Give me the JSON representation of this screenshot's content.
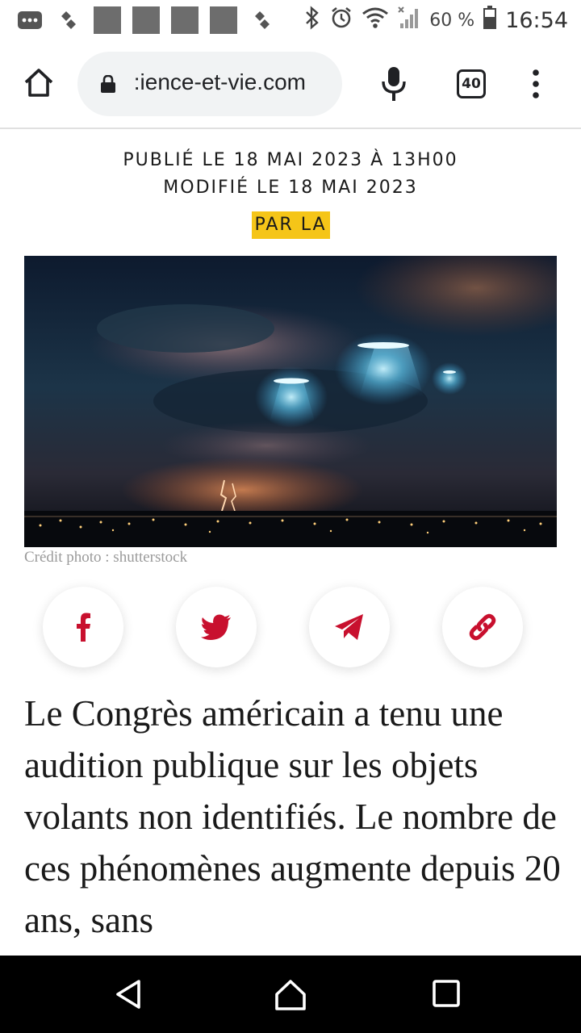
{
  "status_bar": {
    "battery_text": "60 %",
    "time": "16:54",
    "icons": [
      "messages-icon",
      "sync-icon",
      "app-square-icon",
      "app-square-icon",
      "app-square-icon",
      "app-square-icon",
      "sync-icon",
      "bluetooth-icon",
      "alarm-icon",
      "wifi-icon",
      "signal-icon",
      "battery-icon"
    ]
  },
  "browser": {
    "url": " :ience-et-vie.com",
    "tab_count": "40",
    "icons": [
      "home-icon",
      "lock-icon",
      "mic-icon",
      "tabs-icon",
      "more-vert-icon"
    ]
  },
  "article": {
    "published": "PUBLIÉ LE 18 MAI 2023 À 13H00",
    "modified": "MODIFIÉ LE 18 MAI 2023",
    "byline": "PAR LA",
    "photo_credit": "Crédit photo : shutterstock",
    "lead": "Le Congrès américain a tenu une audition publique sur les objets volants non identifiés. Le nombre de ces phénomènes augmente depuis 20 ans, sans",
    "accent_color": "#f5c518",
    "share_color": "#c8102e"
  },
  "share": {
    "icons": [
      "facebook-icon",
      "twitter-icon",
      "telegram-icon",
      "link-icon"
    ]
  },
  "nav": {
    "icons": [
      "back-icon",
      "home-icon",
      "recents-icon"
    ]
  }
}
